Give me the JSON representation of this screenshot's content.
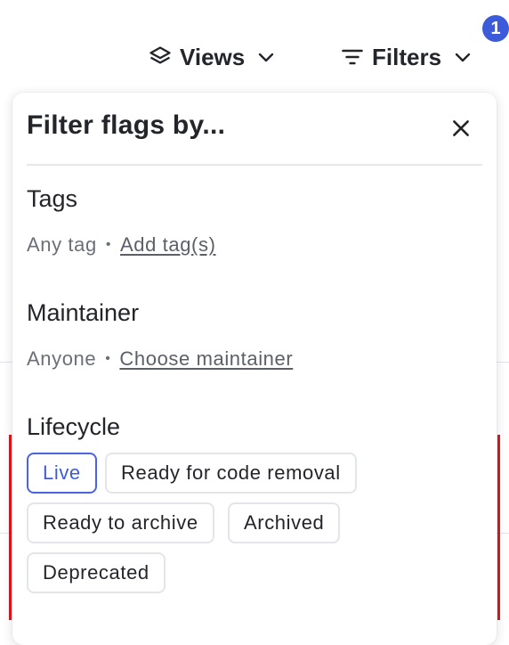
{
  "toolbar": {
    "views_label": "Views",
    "filters_label": "Filters",
    "filters_count": "1"
  },
  "panel": {
    "title": "Filter flags by...",
    "sections": {
      "tags": {
        "title": "Tags",
        "value": "Any tag",
        "separator": "•",
        "link": "Add tag(s)"
      },
      "maintainer": {
        "title": "Maintainer",
        "value": "Anyone",
        "separator": "•",
        "link": "Choose maintainer"
      },
      "lifecycle": {
        "title": "Lifecycle",
        "options": [
          {
            "label": "Live",
            "selected": true
          },
          {
            "label": "Ready for code removal",
            "selected": false
          },
          {
            "label": "Ready to archive",
            "selected": false
          },
          {
            "label": "Archived",
            "selected": false
          },
          {
            "label": "Deprecated",
            "selected": false
          }
        ]
      }
    }
  },
  "colors": {
    "accent": "#3b5bdb",
    "selected_border": "#4b63e0",
    "background_alert": "#e0151a"
  },
  "icons": {
    "views": "layers-icon",
    "filters": "filter-lines-icon",
    "chevron": "chevron-down-icon",
    "close": "close-icon"
  }
}
